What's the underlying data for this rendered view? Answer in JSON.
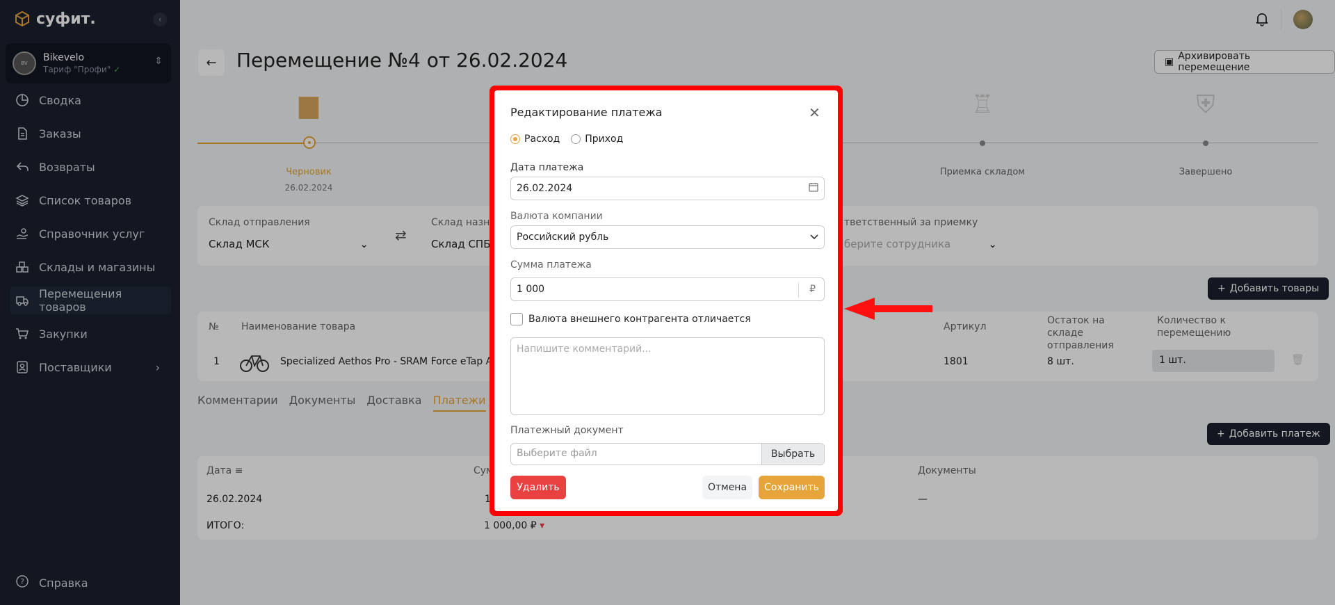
{
  "sidebar": {
    "logo": "суфит.",
    "company": {
      "name": "Bikevelo",
      "tariff": "Тариф \"Профи\""
    },
    "items": [
      {
        "label": "Сводка"
      },
      {
        "label": "Заказы"
      },
      {
        "label": "Возвраты"
      },
      {
        "label": "Список товаров"
      },
      {
        "label": "Справочник услуг"
      },
      {
        "label": "Склады и магазины"
      },
      {
        "label": "Перемещения товаров"
      },
      {
        "label": "Закупки"
      },
      {
        "label": "Поставщики"
      }
    ],
    "help": "Справка"
  },
  "page": {
    "title": "Перемещение №4 от 26.02.2024",
    "archive_button": "Архивировать перемещение",
    "steps": [
      {
        "label": "Черновик",
        "date": "26.02.2024"
      },
      {
        "label": "Приемка складом",
        "date": ""
      },
      {
        "label": "Завершено",
        "date": ""
      }
    ],
    "filters": {
      "from_label": "Склад отправления",
      "from_value": "Склад МСК",
      "to_label": "Склад назна",
      "to_value": "Склад СПБ",
      "resp_label": "тветственный за приемку",
      "resp_placeholder": "берите сотрудника"
    },
    "add_goods": "Добавить товары",
    "goods_table": {
      "headers": [
        "№",
        "Наименование товара",
        "Артикул",
        "Остаток на складе отправления",
        "Количество к перемещению"
      ],
      "row": {
        "num": "1",
        "name": "Specialized Aethos Pro - SRAM Force eTap AXS",
        "sku": "1801",
        "stock": "8 шт.",
        "qty": "1 шт."
      }
    },
    "tabs": [
      "Комментарии",
      "Документы",
      "Доставка",
      "Платежи"
    ],
    "add_payment": "Добавить платеж",
    "payments_table": {
      "headers": {
        "date": "Дата",
        "sum": "Сум",
        "docs": "Документы"
      },
      "row": {
        "date": "26.02.2024",
        "sum": "1",
        "docs": "—"
      },
      "total_label": "ИТОГО:",
      "total_value": "1 000,00 ₽"
    }
  },
  "modal": {
    "title": "Редактирование платежа",
    "radio_expense": "Расход",
    "radio_income": "Приход",
    "date_label": "Дата платежа",
    "date_value": "26.02.2024",
    "currency_label": "Валюта компании",
    "currency_value": "Российский рубль",
    "amount_label": "Сумма платежа",
    "amount_value": "1 000",
    "amount_currency": "₽",
    "checkbox_label": "Валюта внешнего контрагента отличается",
    "comment_placeholder": "Напишите комментарий...",
    "doc_label": "Платежный документ",
    "file_placeholder": "Выберите файл",
    "file_button": "Выбрать",
    "delete": "Удалить",
    "cancel": "Отмена",
    "save": "Сохранить"
  },
  "colors": {
    "accent": "#e6a43a",
    "danger": "#e94040",
    "sidebar": "#1a202e",
    "highlight": "#ff0000"
  }
}
